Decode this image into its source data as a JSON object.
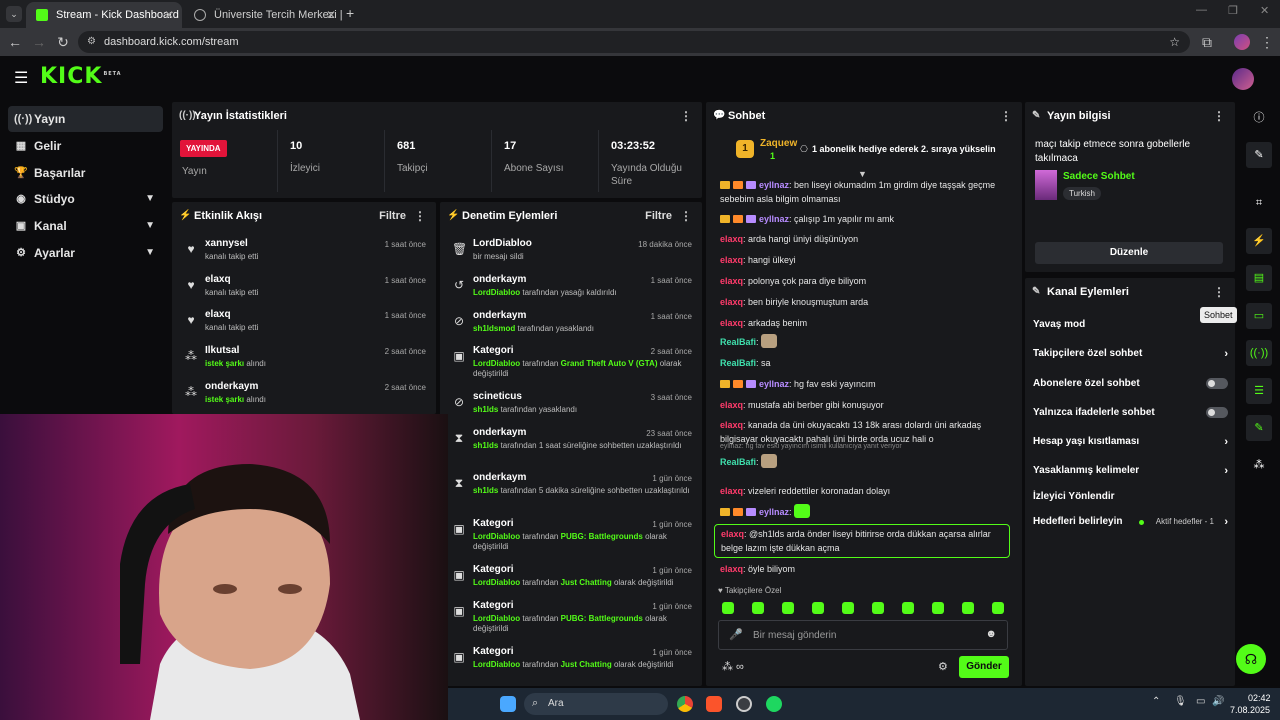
{
  "browser": {
    "tabs": [
      {
        "title": "Stream - Kick Dashboard",
        "active": true
      },
      {
        "title": "Üniversite Tercih Merkezi | Üniv",
        "active": false
      }
    ],
    "url": "dashboard.kick.com/stream"
  },
  "sidebar": {
    "items": [
      {
        "label": "Yayın",
        "icon": "broadcast-icon",
        "active": true
      },
      {
        "label": "Gelir",
        "icon": "revenue-icon"
      },
      {
        "label": "Başarılar",
        "icon": "trophy-icon"
      },
      {
        "label": "Stüdyo",
        "icon": "studio-icon",
        "expandable": true
      },
      {
        "label": "Kanal",
        "icon": "channel-icon",
        "expandable": true
      },
      {
        "label": "Ayarlar",
        "icon": "gear-icon",
        "expandable": true
      }
    ]
  },
  "stats": {
    "title": "Yayın İstatistikleri",
    "live_badge": "YAYINDA",
    "live_label": "Yayın",
    "viewers": {
      "value": "10",
      "label": "İzleyici"
    },
    "followers": {
      "value": "681",
      "label": "Takipçi"
    },
    "subs": {
      "value": "17",
      "label": "Abone Sayısı"
    },
    "duration": {
      "value": "03:23:52",
      "label": "Yayında Olduğu Süre"
    }
  },
  "activity": {
    "title": "Etkinlik Akışı",
    "filter": "Filtre",
    "items": [
      {
        "name": "xannysel",
        "sub": "kanalı takip etti",
        "time": "1 saat önce"
      },
      {
        "name": "elaxq",
        "sub": "kanalı takip etti",
        "time": "1 saat önce"
      },
      {
        "name": "elaxq",
        "sub": "kanalı takip etti",
        "time": "1 saat önce"
      },
      {
        "name": "Ilkutsal",
        "sub_hl": "istek şarkı",
        "sub": "alındı",
        "time": "2 saat önce"
      },
      {
        "name": "onderkaym",
        "sub_hl": "istek şarkı",
        "sub": "alındı",
        "time": "2 saat önce"
      }
    ]
  },
  "moderation": {
    "title": "Denetim Eylemleri",
    "filter": "Filtre",
    "items": [
      {
        "name": "LordDiabloo",
        "pre": "",
        "sub": "bir mesajı sildi",
        "time": "18 dakika önce"
      },
      {
        "name": "onderkaym",
        "pre": "LordDiabloo",
        "sub": "tarafından yasağı kaldırıldı",
        "time": "1 saat önce"
      },
      {
        "name": "onderkaym",
        "pre": "sh1ldsmod",
        "sub": "tarafından yasaklandı",
        "time": "1 saat önce"
      },
      {
        "name": "Kategori",
        "pre": "LordDiabloo",
        "sub": "tarafından",
        "hl2": "Grand Theft Auto V (GTA)",
        "sub2": "olarak değiştirildi",
        "time": "2 saat önce"
      },
      {
        "name": "scineticus",
        "pre": "sh1lds",
        "sub": "tarafından yasaklandı",
        "time": "3 saat önce"
      },
      {
        "name": "onderkaym",
        "pre": "sh1lds",
        "sub": "tarafından 1 saat süreliğine sohbetten uzaklaştırıldı",
        "time": "23 saat önce"
      },
      {
        "name": "onderkaym",
        "pre": "sh1lds",
        "sub": "tarafından 5 dakika süreliğine sohbetten uzaklaştırıldı",
        "time": "1 gün önce"
      },
      {
        "name": "Kategori",
        "pre": "LordDiabloo",
        "sub": "tarafından",
        "hl2": "PUBG: Battlegrounds",
        "sub2": "olarak değiştirildi",
        "time": "1 gün önce"
      },
      {
        "name": "Kategori",
        "pre": "LordDiabloo",
        "sub": "tarafından",
        "hl2": "Just Chatting",
        "sub2": "olarak değiştirildi",
        "time": "1 gün önce"
      },
      {
        "name": "Kategori",
        "pre": "LordDiabloo",
        "sub": "tarafından",
        "hl2": "PUBG: Battlegrounds",
        "sub2": "olarak değiştirildi",
        "time": "1 gün önce"
      },
      {
        "name": "Kategori",
        "pre": "LordDiabloo",
        "sub": "tarafından",
        "hl2": "Just Chatting",
        "sub2": "olarak değiştirildi",
        "time": "1 gün önce"
      }
    ]
  },
  "chat": {
    "title": "Sohbet",
    "pinned_user": "Zaquew",
    "pinned_count": "1",
    "pinned_msg": "1 abonelik hediye ederek 2. sıraya yükselin",
    "messages": [
      {
        "user": "eyllnaz",
        "cls": "u-eyl",
        "badges": true,
        "text": "ben liseyi okumadım 1m girdim diye taşşak geçme sebebim asla bilgim olmaması"
      },
      {
        "user": "eyllnaz",
        "cls": "u-eyl",
        "badges": true,
        "text": "çalışıp 1m yapılır mı amk"
      },
      {
        "user": "elaxq",
        "cls": "u-elaxq",
        "text": "arda hangi üniyi düşünüyon"
      },
      {
        "user": "elaxq",
        "cls": "u-elaxq",
        "text": "hangi ülkeyi"
      },
      {
        "user": "elaxq",
        "cls": "u-elaxq",
        "text": "polonya çok para diye biliyom"
      },
      {
        "user": "elaxq",
        "cls": "u-elaxq",
        "text": "ben biriyle knouşmuştum arda"
      },
      {
        "user": "elaxq",
        "cls": "u-elaxq",
        "text": "arkadaş benim"
      },
      {
        "user": "RealBafi",
        "cls": "u-real",
        "text": ""
      },
      {
        "user": "RealBafi",
        "cls": "u-real",
        "text": "sa"
      },
      {
        "user": "eyllnaz",
        "cls": "u-eyl",
        "badges": true,
        "text": "hg fav eski yayıncım"
      },
      {
        "user": "elaxq",
        "cls": "u-elaxq",
        "text": "mustafa abi berber gibi konuşuyor"
      },
      {
        "user": "elaxq",
        "cls": "u-elaxq",
        "text": "kanada da üni okuyacaktı 13 18k arası dolardı üni arkadaş bilgisayar okuyacaktı pahalı üni birde orda ucuz hali o"
      },
      {
        "user": "RealBafi",
        "cls": "u-real",
        "text": "",
        "reply": "eyllnaz: hg fav eski yayıncım isimli kullanıcıya yanıt veriyor"
      },
      {
        "user": "elaxq",
        "cls": "u-elaxq",
        "text": "vizeleri reddettiler koronadan dolayı"
      },
      {
        "user": "eyllnaz",
        "cls": "u-eyl",
        "badges": true,
        "text": ""
      },
      {
        "user": "elaxq",
        "cls": "u-elaxq",
        "text": "@sh1lds arda önder liseyi bitirirse orda dükkan açarsa alırlar belge lazım işte dükkan açma",
        "highlight": true
      },
      {
        "user": "elaxq",
        "cls": "u-elaxq",
        "text": "öyle biliyom"
      }
    ],
    "followers_only_label": "Takipçilere Özel",
    "input_placeholder": "Bir mesaj gönderin",
    "send_label": "Gönder"
  },
  "stream_info": {
    "title": "Yayın bilgisi",
    "stream_title": "maçı takip etmece sonra gobellerle takılmaca",
    "category": "Sadece Sohbet",
    "tag": "Turkish",
    "edit_label": "Düzenle"
  },
  "channel_actions": {
    "title": "Kanal Eylemleri",
    "tooltip": "Sohbet",
    "items": [
      {
        "label": "Yavaş mod",
        "kind": "none"
      },
      {
        "label": "Takipçilere özel sohbet",
        "kind": "arrow"
      },
      {
        "label": "Abonelere özel sohbet",
        "kind": "toggle"
      },
      {
        "label": "Yalnızca ifadelerle sohbet",
        "kind": "toggle"
      },
      {
        "label": "Hesap yaşı kısıtlaması",
        "kind": "arrow"
      },
      {
        "label": "Yasaklanmış kelimeler",
        "kind": "arrow"
      },
      {
        "label": "İzleyici Yönlendir",
        "kind": "none"
      },
      {
        "label": "Hedefleri belirleyin",
        "kind": "arrow",
        "extra": "Aktif hedefler - 1"
      }
    ]
  },
  "taskbar": {
    "search": "Ara",
    "time": "02:42",
    "date": "7.08.2025"
  },
  "colors": {
    "accent": "#53fc18",
    "live": "#e2143a",
    "panel": "#18191c"
  }
}
